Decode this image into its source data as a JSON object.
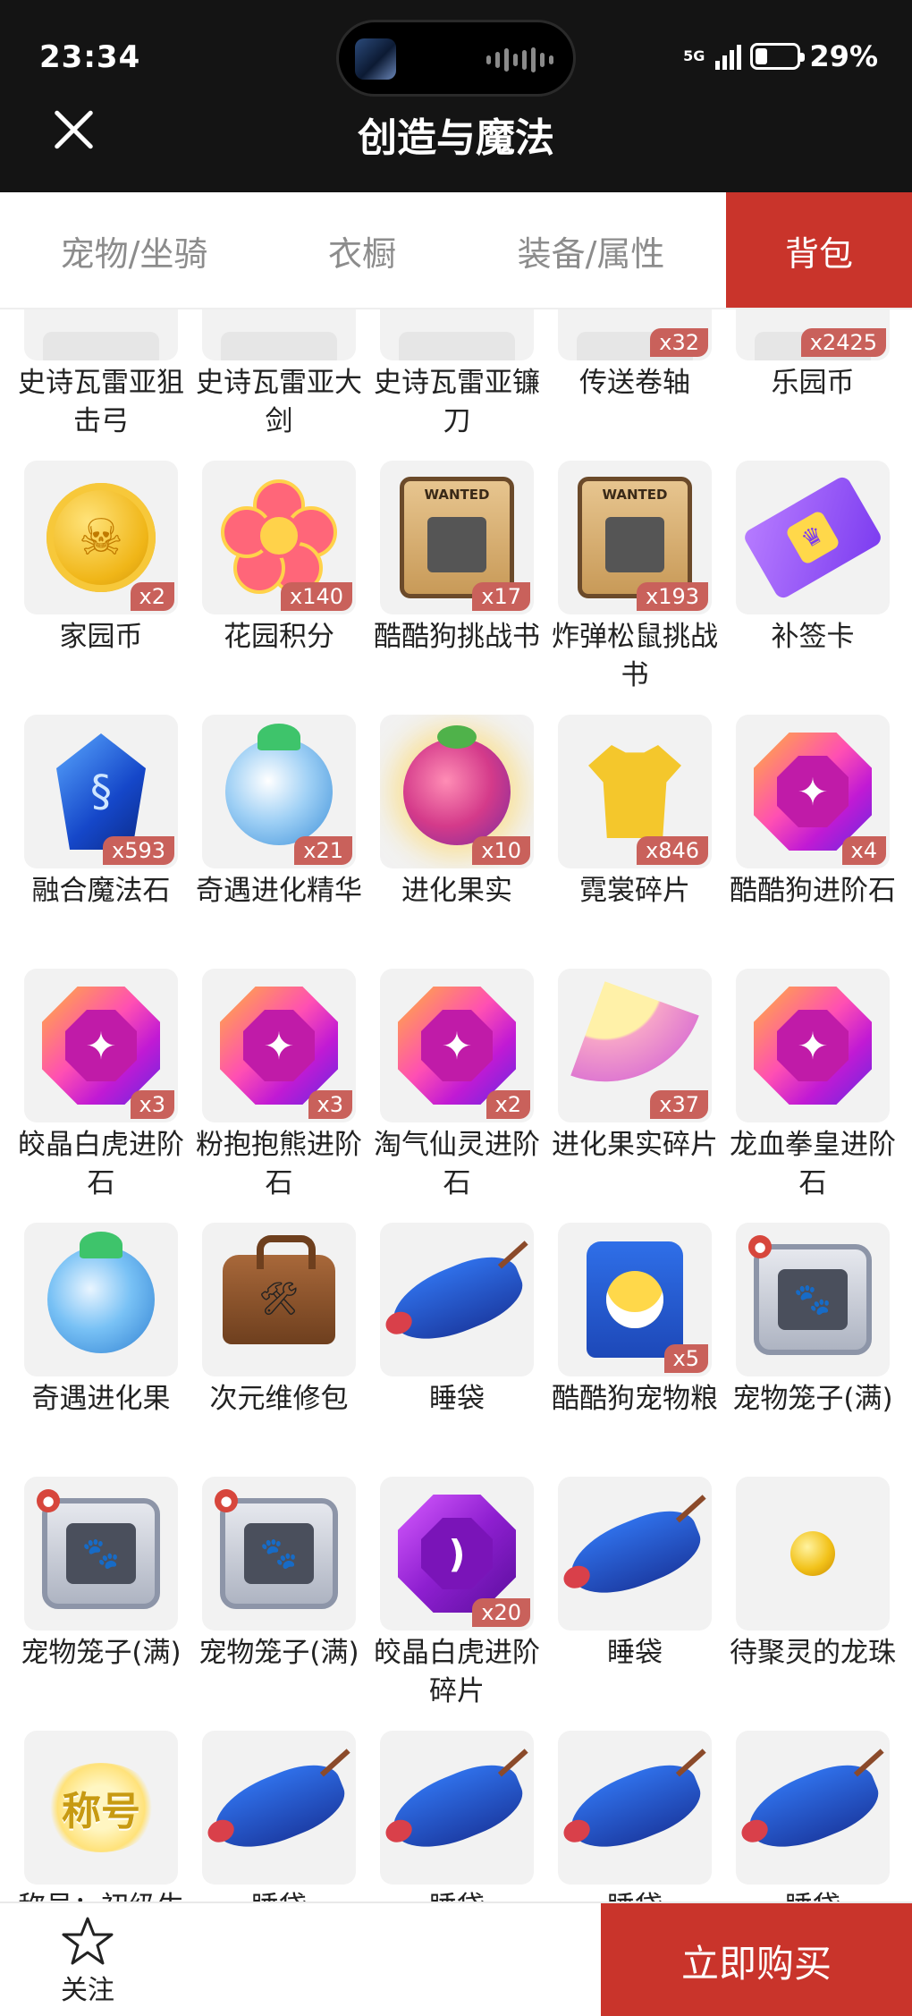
{
  "status": {
    "time": "23:34",
    "network": "5G",
    "battery": "29%",
    "battery_level": 0.29
  },
  "header": {
    "title": "创造与魔法"
  },
  "tabs": [
    {
      "label": "宠物/坐骑",
      "active": false
    },
    {
      "label": "衣橱",
      "active": false
    },
    {
      "label": "装备/属性",
      "active": false
    },
    {
      "label": "背包",
      "active": true
    }
  ],
  "items": [
    {
      "name": "史诗瓦雷亚狙击弓",
      "count": "",
      "icon": "bow-icon"
    },
    {
      "name": "史诗瓦雷亚大剑",
      "count": "",
      "icon": "sword-icon"
    },
    {
      "name": "史诗瓦雷亚镰刀",
      "count": "",
      "icon": "scythe-icon"
    },
    {
      "name": "传送卷轴",
      "count": "x32",
      "icon": "teleport-scroll-icon"
    },
    {
      "name": "乐园币",
      "count": "x2425",
      "icon": "park-coin-icon"
    },
    {
      "name": "家园币",
      "count": "x2",
      "icon": "home-coin-icon"
    },
    {
      "name": "花园积分",
      "count": "x140",
      "icon": "garden-points-icon"
    },
    {
      "name": "酷酷狗挑战书",
      "count": "x17",
      "icon": "wanted-poster-icon"
    },
    {
      "name": "炸弹松鼠挑战书",
      "count": "x193",
      "icon": "wanted-poster-icon"
    },
    {
      "name": "补签卡",
      "count": "",
      "icon": "ticket-icon"
    },
    {
      "name": "融合魔法石",
      "count": "x593",
      "icon": "magic-crystal-icon"
    },
    {
      "name": "奇遇进化精华",
      "count": "x21",
      "icon": "evolution-essence-icon"
    },
    {
      "name": "进化果实",
      "count": "x10",
      "icon": "evolution-fruit-icon"
    },
    {
      "name": "霓裳碎片",
      "count": "x846",
      "icon": "shirt-icon"
    },
    {
      "name": "酷酷狗进阶石",
      "count": "x4",
      "icon": "advance-gem-icon"
    },
    {
      "name": "皎晶白虎进阶石",
      "count": "x3",
      "icon": "advance-gem-icon"
    },
    {
      "name": "粉抱抱熊进阶石",
      "count": "x3",
      "icon": "advance-gem-icon"
    },
    {
      "name": "淘气仙灵进阶石",
      "count": "x2",
      "icon": "advance-gem-icon"
    },
    {
      "name": "进化果实碎片",
      "count": "x37",
      "icon": "fruit-slice-icon"
    },
    {
      "name": "龙血拳皇进阶石",
      "count": "",
      "icon": "advance-gem-icon"
    },
    {
      "name": "奇遇进化果",
      "count": "",
      "icon": "evolution-orb-icon"
    },
    {
      "name": "次元维修包",
      "count": "",
      "icon": "repair-bag-icon"
    },
    {
      "name": "睡袋",
      "count": "",
      "icon": "sleeping-bag-icon"
    },
    {
      "name": "酷酷狗宠物粮",
      "count": "x5",
      "icon": "pet-food-icon"
    },
    {
      "name": "宠物笼子(满)",
      "count": "",
      "icon": "pet-cage-icon"
    },
    {
      "name": "宠物笼子(满)",
      "count": "",
      "icon": "pet-cage-icon"
    },
    {
      "name": "宠物笼子(满)",
      "count": "",
      "icon": "pet-cage-icon"
    },
    {
      "name": "皎晶白虎进阶碎片",
      "count": "x20",
      "icon": "purple-gem-icon"
    },
    {
      "name": "睡袋",
      "count": "",
      "icon": "sleeping-bag-icon"
    },
    {
      "name": "待聚灵的龙珠",
      "count": "",
      "icon": "dragon-ball-icon"
    },
    {
      "name": "称号：初级生涯开采者",
      "count": "",
      "icon": "title-badge-icon",
      "art_text": "称号"
    },
    {
      "name": "睡袋",
      "count": "",
      "icon": "sleeping-bag-icon"
    },
    {
      "name": "睡袋",
      "count": "",
      "icon": "sleeping-bag-icon"
    },
    {
      "name": "睡袋",
      "count": "",
      "icon": "sleeping-bag-icon"
    },
    {
      "name": "睡袋",
      "count": "",
      "icon": "sleeping-bag-icon"
    }
  ],
  "footer": {
    "follow_label": "关注",
    "buy_label": "立即购买"
  },
  "colors": {
    "accent": "#c9342b",
    "badge": "#c9615b",
    "header_bg": "#141414"
  }
}
